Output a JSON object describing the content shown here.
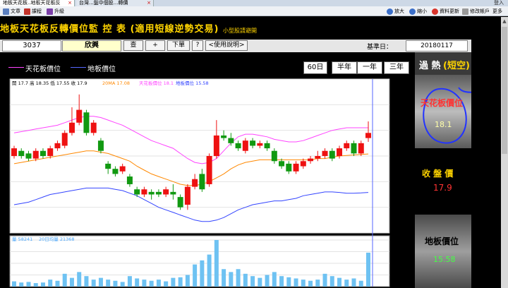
{
  "browser": {
    "tabs": [
      {
        "label": "地板天花板..地板天花板反"
      },
      {
        "label": "台灣...盤中個股...轉價"
      }
    ],
    "right_links": "登入",
    "menu_left": [
      {
        "label": "文章"
      },
      {
        "label": "課程"
      },
      {
        "label": "升級"
      }
    ],
    "menu_right": [
      {
        "label": "放大"
      },
      {
        "label": "縮小"
      },
      {
        "label": "資料更新"
      },
      {
        "label": "修改帳戶"
      },
      {
        "label": "更多"
      }
    ]
  },
  "page": {
    "title": "地板天花板反轉價位監 控 表 (適用短線逆勢交易)",
    "sub_link": "小型股請避開"
  },
  "toolbar": {
    "stock_code": "3037",
    "stock_name": "欣興",
    "query_label": "查",
    "plus_label": "+",
    "order_label": "下單",
    "help_q": "?",
    "usage_label": "<使用說明>",
    "date_label": "基準日：",
    "date_value": "20180117"
  },
  "legend": [
    {
      "label": "天花板價位",
      "color": "#ff44ff"
    },
    {
      "label": "地板價位",
      "color": "#5566ff"
    }
  ],
  "periods": [
    {
      "label": "60日"
    },
    {
      "label": "半年"
    },
    {
      "label": "一年"
    },
    {
      "label": "三年"
    }
  ],
  "info_line": [
    {
      "text": "開 17.7 高 18.35 低 17.55 收 17.9",
      "color": "#000000"
    },
    {
      "text": "20MA 17.08",
      "color": "#ff8800"
    },
    {
      "text": "天花板價位 18.1",
      "color": "#ff44ff"
    },
    {
      "text": "地板價位 15.58",
      "color": "#3344ff"
    }
  ],
  "vol_line": [
    {
      "text": "量 58241",
      "color": "#4aa8ff"
    },
    {
      "text": "20日均量 21368",
      "color": "#4aa8ff"
    }
  ],
  "side": {
    "status_prefix": "過 熱",
    "status_suffix": "(短空)",
    "ceiling_label": "天花板價位",
    "ceiling_value": "18.1",
    "close_label": "收 盤 價",
    "close_value": "17.9",
    "floor_label": "地板價位",
    "floor_value": "15.58"
  },
  "chart_data": {
    "type": "candlestick",
    "price_axis": {
      "min": 14,
      "max": 20,
      "ticks": [
        20,
        19,
        18,
        17,
        16,
        15,
        14
      ]
    },
    "volume_axis": {
      "min": 0,
      "max": 80000,
      "ticks": [
        "80,000",
        "60,000",
        "40,000",
        "20,000"
      ]
    },
    "candles": [
      {
        "o": 17.0,
        "c": 17.3,
        "h": 17.4,
        "l": 16.9,
        "v": 9000
      },
      {
        "o": 17.2,
        "c": 17.0,
        "h": 17.3,
        "l": 16.9,
        "v": 7000
      },
      {
        "o": 17.1,
        "c": 16.9,
        "h": 17.2,
        "l": 16.8,
        "v": 8000
      },
      {
        "o": 16.9,
        "c": 17.2,
        "h": 17.3,
        "l": 16.8,
        "v": 6000
      },
      {
        "o": 17.2,
        "c": 17.0,
        "h": 17.3,
        "l": 16.9,
        "v": 7000
      },
      {
        "o": 17.0,
        "c": 17.3,
        "h": 17.4,
        "l": 16.9,
        "v": 12000
      },
      {
        "o": 17.3,
        "c": 17.5,
        "h": 17.6,
        "l": 17.2,
        "v": 10000
      },
      {
        "o": 17.4,
        "c": 17.9,
        "h": 18.0,
        "l": 17.3,
        "v": 22000
      },
      {
        "o": 17.9,
        "c": 18.3,
        "h": 18.9,
        "l": 17.8,
        "v": 15000
      },
      {
        "o": 18.3,
        "c": 18.8,
        "h": 19.4,
        "l": 18.2,
        "v": 25000
      },
      {
        "o": 18.7,
        "c": 17.9,
        "h": 18.8,
        "l": 17.8,
        "v": 18000
      },
      {
        "o": 17.9,
        "c": 18.3,
        "h": 18.4,
        "l": 17.8,
        "v": 12000
      },
      {
        "o": 17.6,
        "c": 17.2,
        "h": 17.7,
        "l": 17.1,
        "v": 15000
      },
      {
        "o": 16.7,
        "c": 16.5,
        "h": 16.8,
        "l": 16.3,
        "v": 12000
      },
      {
        "o": 16.5,
        "c": 16.3,
        "h": 16.6,
        "l": 16.2,
        "v": 10000
      },
      {
        "o": 16.4,
        "c": 16.6,
        "h": 16.7,
        "l": 16.3,
        "v": 8000
      },
      {
        "o": 16.2,
        "c": 15.9,
        "h": 16.3,
        "l": 15.8,
        "v": 18000
      },
      {
        "o": 15.7,
        "c": 15.5,
        "h": 15.8,
        "l": 15.4,
        "v": 14000
      },
      {
        "o": 15.5,
        "c": 15.7,
        "h": 15.8,
        "l": 15.4,
        "v": 12000
      },
      {
        "o": 15.6,
        "c": 15.5,
        "h": 15.7,
        "l": 15.3,
        "v": 10000
      },
      {
        "o": 15.6,
        "c": 15.5,
        "h": 15.7,
        "l": 15.4,
        "v": 12000
      },
      {
        "o": 15.5,
        "c": 15.7,
        "h": 15.8,
        "l": 15.4,
        "v": 9000
      },
      {
        "o": 15.6,
        "c": 15.5,
        "h": 15.9,
        "l": 15.3,
        "v": 15000
      },
      {
        "o": 15.4,
        "c": 15.0,
        "h": 15.5,
        "l": 14.9,
        "v": 16000
      },
      {
        "o": 15.1,
        "c": 15.8,
        "h": 15.9,
        "l": 14.9,
        "v": 20000
      },
      {
        "o": 15.8,
        "c": 16.1,
        "h": 16.3,
        "l": 15.7,
        "v": 38000
      },
      {
        "o": 16.3,
        "c": 15.7,
        "h": 16.5,
        "l": 15.6,
        "v": 45000
      },
      {
        "o": 15.9,
        "c": 17.0,
        "h": 17.1,
        "l": 15.8,
        "v": 55000
      },
      {
        "o": 17.0,
        "c": 17.8,
        "h": 18.4,
        "l": 16.9,
        "v": 80000
      },
      {
        "o": 17.8,
        "c": 17.7,
        "h": 18.0,
        "l": 17.6,
        "v": 30000
      },
      {
        "o": 17.7,
        "c": 17.5,
        "h": 17.9,
        "l": 17.4,
        "v": 25000
      },
      {
        "o": 17.5,
        "c": 17.3,
        "h": 17.6,
        "l": 17.2,
        "v": 30000
      },
      {
        "o": 17.2,
        "c": 17.6,
        "h": 17.7,
        "l": 17.1,
        "v": 22000
      },
      {
        "o": 17.6,
        "c": 17.4,
        "h": 17.7,
        "l": 17.3,
        "v": 18000
      },
      {
        "o": 17.4,
        "c": 17.5,
        "h": 17.6,
        "l": 17.3,
        "v": 15000
      },
      {
        "o": 17.5,
        "c": 17.3,
        "h": 17.6,
        "l": 17.2,
        "v": 20000
      },
      {
        "o": 17.2,
        "c": 16.8,
        "h": 17.3,
        "l": 16.7,
        "v": 25000
      },
      {
        "o": 16.8,
        "c": 16.6,
        "h": 16.9,
        "l": 16.5,
        "v": 18000
      },
      {
        "o": 16.7,
        "c": 16.4,
        "h": 16.8,
        "l": 16.3,
        "v": 16000
      },
      {
        "o": 16.4,
        "c": 16.7,
        "h": 16.8,
        "l": 16.3,
        "v": 14000
      },
      {
        "o": 16.6,
        "c": 16.8,
        "h": 16.9,
        "l": 16.5,
        "v": 12000
      },
      {
        "o": 16.8,
        "c": 16.9,
        "h": 17.0,
        "l": 16.7,
        "v": 10000
      },
      {
        "o": 16.9,
        "c": 17.0,
        "h": 17.2,
        "l": 16.8,
        "v": 12000
      },
      {
        "o": 17.0,
        "c": 17.2,
        "h": 17.3,
        "l": 16.9,
        "v": 22000
      },
      {
        "o": 17.2,
        "c": 16.9,
        "h": 17.3,
        "l": 16.8,
        "v": 18000
      },
      {
        "o": 17.0,
        "c": 17.3,
        "h": 17.4,
        "l": 16.9,
        "v": 15000
      },
      {
        "o": 17.3,
        "c": 17.5,
        "h": 17.6,
        "l": 17.2,
        "v": 12000
      },
      {
        "o": 17.5,
        "c": 17.1,
        "h": 17.6,
        "l": 17.0,
        "v": 14000
      },
      {
        "o": 17.1,
        "c": 17.5,
        "h": 17.6,
        "l": 17.0,
        "v": 10000
      },
      {
        "o": 17.7,
        "c": 17.9,
        "h": 18.35,
        "l": 17.55,
        "v": 58241
      }
    ],
    "ceiling": [
      17.9,
      17.95,
      18.0,
      18.05,
      18.1,
      18.15,
      18.2,
      18.3,
      18.4,
      18.5,
      18.55,
      18.55,
      18.5,
      18.4,
      18.3,
      18.2,
      18.05,
      17.9,
      17.75,
      17.6,
      17.5,
      17.4,
      17.3,
      17.1,
      16.9,
      16.75,
      16.7,
      16.75,
      16.9,
      17.2,
      17.5,
      17.75,
      17.85,
      17.85,
      17.8,
      17.75,
      17.65,
      17.6,
      17.55,
      17.55,
      17.6,
      17.7,
      17.8,
      17.9,
      18.0,
      18.05,
      18.1,
      18.1,
      18.1,
      18.1
    ],
    "ma20": [
      16.7,
      16.75,
      16.8,
      16.85,
      16.9,
      16.95,
      17.0,
      17.05,
      17.1,
      17.15,
      17.2,
      17.2,
      17.15,
      17.1,
      17.0,
      16.9,
      16.8,
      16.6,
      16.45,
      16.3,
      16.2,
      16.1,
      16.0,
      15.9,
      15.85,
      15.85,
      15.9,
      16.0,
      16.15,
      16.3,
      16.5,
      16.65,
      16.75,
      16.8,
      16.85,
      16.85,
      16.85,
      16.85,
      16.85,
      16.85,
      16.85,
      16.85,
      16.9,
      16.9,
      16.95,
      17.0,
      17.02,
      17.04,
      17.06,
      17.08
    ],
    "floor": [
      15.1,
      15.15,
      15.2,
      15.3,
      15.4,
      15.5,
      15.55,
      15.6,
      15.65,
      15.7,
      15.75,
      15.75,
      15.75,
      15.75,
      15.7,
      15.65,
      15.55,
      15.45,
      15.3,
      15.15,
      15.0,
      14.9,
      14.8,
      14.7,
      14.6,
      14.5,
      14.45,
      14.45,
      14.5,
      14.6,
      14.75,
      14.9,
      15.0,
      15.1,
      15.15,
      15.2,
      15.25,
      15.25,
      15.3,
      15.35,
      15.45,
      15.5,
      15.55,
      15.6,
      15.6,
      15.58,
      15.55,
      15.55,
      15.56,
      15.58
    ]
  }
}
